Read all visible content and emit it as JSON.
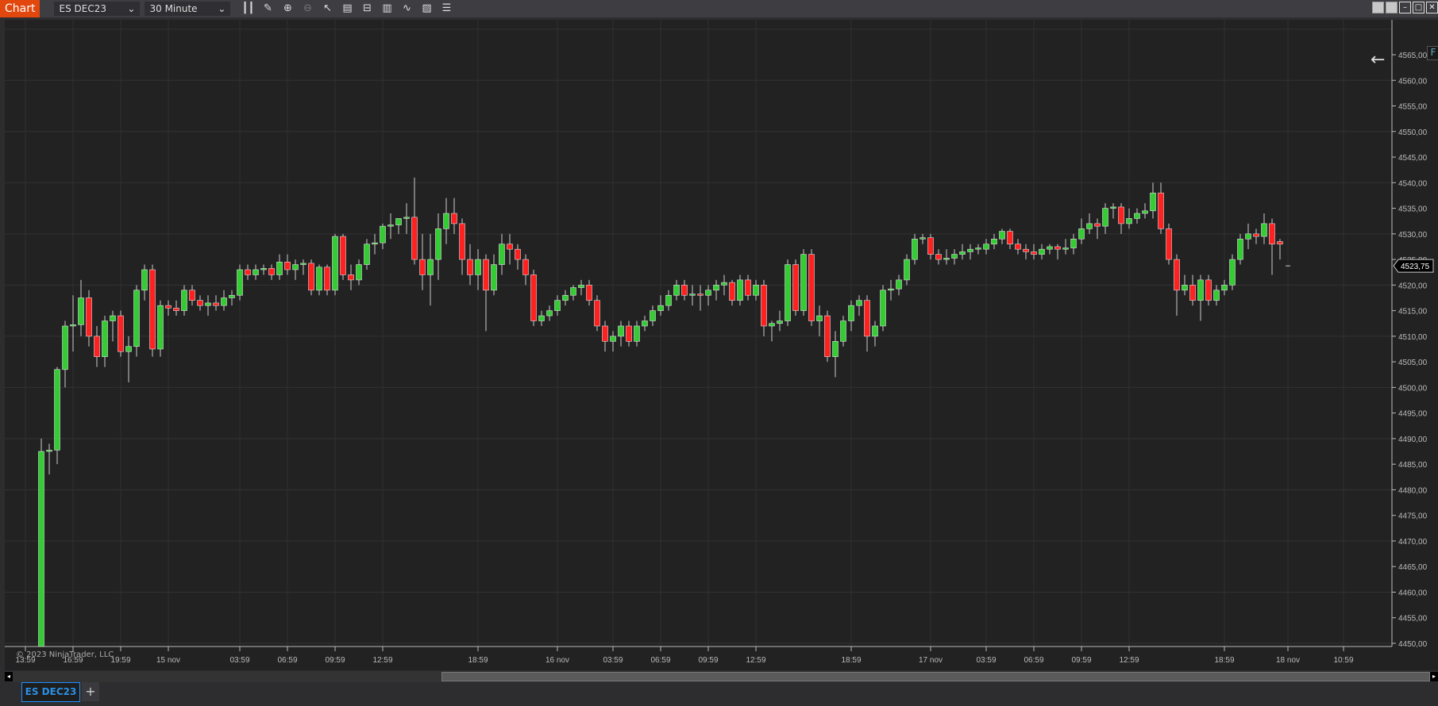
{
  "toolbar": {
    "title": "Chart",
    "instrument": "ES DEC23",
    "interval": "30 Minute",
    "tools": [
      "bar-chart-icon",
      "pencil-icon",
      "zoom-in-icon",
      "zoom-out-icon",
      "pointer-icon",
      "data-box-icon",
      "properties-icon",
      "indicators-icon",
      "strategies-icon",
      "templates-icon",
      "list-icon"
    ]
  },
  "chart": {
    "copyright": "© 2023 NinjaTrader, LLC",
    "f_button": "F",
    "current_price": "4523,75",
    "current_value": 4523.75,
    "colors": {
      "up": "#33cc33",
      "down": "#ff2020",
      "bg": "#222222",
      "grid": "#333333"
    },
    "price_labels": [
      "4565,00",
      "4560,00",
      "4555,00",
      "4550,00",
      "4545,00",
      "4540,00",
      "4535,00",
      "4530,00",
      "4525,00",
      "4520,00",
      "4515,00",
      "4510,00",
      "4505,00",
      "4500,00",
      "4495,00",
      "4490,00",
      "4485,00",
      "4480,00",
      "4475,00",
      "4470,00",
      "4465,00",
      "4460,00",
      "4455,00",
      "4450,00"
    ],
    "time_labels": [
      [
        "13:59",
        -2
      ],
      [
        "16:59",
        4
      ],
      [
        "19:59",
        10
      ],
      [
        "15 nov",
        16
      ],
      [
        "03:59",
        25
      ],
      [
        "06:59",
        31
      ],
      [
        "09:59",
        37
      ],
      [
        "12:59",
        43
      ],
      [
        "18:59",
        55
      ],
      [
        "16 nov",
        65
      ],
      [
        "03:59",
        72
      ],
      [
        "06:59",
        78
      ],
      [
        "09:59",
        84
      ],
      [
        "12:59",
        90
      ],
      [
        "18:59",
        102
      ],
      [
        "17 nov",
        112
      ],
      [
        "03:59",
        119
      ],
      [
        "06:59",
        125
      ],
      [
        "09:59",
        131
      ],
      [
        "12:59",
        137
      ],
      [
        "18:59",
        149
      ],
      [
        "18 nov",
        157
      ],
      [
        "10:59",
        164
      ]
    ],
    "candles": [
      [
        4448,
        4490,
        4440,
        4487.5
      ],
      [
        4487.5,
        4489,
        4483,
        4487.75
      ],
      [
        4487.75,
        4504,
        4485,
        4503.5
      ],
      [
        4503.5,
        4513,
        4500,
        4512
      ],
      [
        4512,
        4518,
        4507,
        4512.25
      ],
      [
        4512.25,
        4521,
        4510,
        4517.5
      ],
      [
        4517.5,
        4519,
        4508,
        4510
      ],
      [
        4510,
        4512,
        4504,
        4506
      ],
      [
        4506,
        4514,
        4504,
        4513
      ],
      [
        4513,
        4515,
        4509,
        4514
      ],
      [
        4514,
        4515,
        4506,
        4507
      ],
      [
        4507,
        4510,
        4501,
        4508
      ],
      [
        4508,
        4520,
        4506,
        4519
      ],
      [
        4519,
        4524,
        4517,
        4523
      ],
      [
        4523,
        4524,
        4506,
        4507.5
      ],
      [
        4507.5,
        4517,
        4506,
        4516
      ],
      [
        4516,
        4517,
        4514,
        4515.5
      ],
      [
        4515.5,
        4517,
        4514,
        4515
      ],
      [
        4515,
        4520,
        4514,
        4519
      ],
      [
        4519,
        4520,
        4516,
        4517
      ],
      [
        4517,
        4518,
        4515,
        4516
      ],
      [
        4516,
        4518,
        4514,
        4516.5
      ],
      [
        4516.5,
        4518,
        4515,
        4516
      ],
      [
        4516,
        4519,
        4515,
        4517.5
      ],
      [
        4517.5,
        4519,
        4516,
        4518
      ],
      [
        4518,
        4524,
        4517,
        4523
      ],
      [
        4523,
        4524,
        4521,
        4522
      ],
      [
        4522,
        4524,
        4521,
        4523
      ],
      [
        4523,
        4524,
        4522,
        4523.25
      ],
      [
        4523.25,
        4524,
        4521,
        4522
      ],
      [
        4522,
        4526,
        4521,
        4524.5
      ],
      [
        4524.5,
        4526,
        4522,
        4523
      ],
      [
        4523,
        4525,
        4521,
        4524
      ],
      [
        4524,
        4525,
        4522,
        4524.25
      ],
      [
        4524.25,
        4525,
        4518,
        4519
      ],
      [
        4519,
        4524,
        4518,
        4523.5
      ],
      [
        4523.5,
        4524,
        4518,
        4519
      ],
      [
        4519,
        4530,
        4518,
        4529.5
      ],
      [
        4529.5,
        4530,
        4521,
        4522
      ],
      [
        4522,
        4524,
        4519,
        4521
      ],
      [
        4521,
        4525,
        4520,
        4524
      ],
      [
        4524,
        4529,
        4523,
        4528
      ],
      [
        4528,
        4530,
        4526,
        4528.25
      ],
      [
        4528.25,
        4532,
        4527,
        4531.5
      ],
      [
        4531.5,
        4534,
        4529,
        4531.75
      ],
      [
        4531.75,
        4533,
        4530,
        4533
      ],
      [
        4533,
        4536,
        4530,
        4533.25
      ],
      [
        4533.25,
        4541,
        4524,
        4525
      ],
      [
        4525,
        4530,
        4519,
        4522
      ],
      [
        4522,
        4530,
        4516,
        4525
      ],
      [
        4525,
        4534,
        4521,
        4531
      ],
      [
        4531,
        4537,
        4528,
        4534
      ],
      [
        4534,
        4537,
        4530,
        4532
      ],
      [
        4532,
        4533,
        4522,
        4525
      ],
      [
        4525,
        4528,
        4520,
        4522
      ],
      [
        4522,
        4527,
        4519,
        4525
      ],
      [
        4525,
        4526,
        4511,
        4519
      ],
      [
        4519,
        4526,
        4518,
        4524
      ],
      [
        4524,
        4530,
        4522,
        4528
      ],
      [
        4528,
        4530,
        4524,
        4527
      ],
      [
        4527,
        4528,
        4523,
        4525
      ],
      [
        4525,
        4526,
        4520,
        4522
      ],
      [
        4522,
        4523,
        4512,
        4513
      ],
      [
        4513,
        4515,
        4512,
        4514
      ],
      [
        4514,
        4516,
        4513,
        4515
      ],
      [
        4515,
        4518,
        4514,
        4517
      ],
      [
        4517,
        4519,
        4516,
        4518
      ],
      [
        4518,
        4520,
        4517,
        4519.5
      ],
      [
        4519.5,
        4521,
        4518,
        4520
      ],
      [
        4520,
        4521,
        4516,
        4517
      ],
      [
        4517,
        4518,
        4511,
        4512
      ],
      [
        4512,
        4513,
        4507,
        4509
      ],
      [
        4509,
        4511,
        4507,
        4510
      ],
      [
        4510,
        4513,
        4508,
        4512
      ],
      [
        4512,
        4513,
        4508,
        4509
      ],
      [
        4509,
        4513,
        4508,
        4512
      ],
      [
        4512,
        4514,
        4511,
        4513
      ],
      [
        4513,
        4516,
        4512,
        4515
      ],
      [
        4515,
        4518,
        4514,
        4516
      ],
      [
        4516,
        4519,
        4515,
        4518
      ],
      [
        4518,
        4521,
        4517,
        4520
      ],
      [
        4520,
        4521,
        4517,
        4518
      ],
      [
        4518,
        4520,
        4516,
        4518.25
      ],
      [
        4518.25,
        4520,
        4515,
        4518
      ],
      [
        4518,
        4520,
        4516,
        4519
      ],
      [
        4519,
        4521,
        4517,
        4520
      ],
      [
        4520,
        4522,
        4518,
        4520.5
      ],
      [
        4520.5,
        4521,
        4516,
        4517
      ],
      [
        4517,
        4522,
        4516,
        4521
      ],
      [
        4521,
        4522,
        4517,
        4518
      ],
      [
        4518,
        4521,
        4517,
        4520
      ],
      [
        4520,
        4521,
        4510,
        4512
      ],
      [
        4512,
        4513,
        4509,
        4512.5
      ],
      [
        4512.5,
        4515,
        4511,
        4513
      ],
      [
        4513,
        4525,
        4512,
        4524
      ],
      [
        4524,
        4525,
        4514,
        4515
      ],
      [
        4515,
        4527,
        4514,
        4526
      ],
      [
        4526,
        4527,
        4512,
        4513
      ],
      [
        4513,
        4516,
        4510,
        4514
      ],
      [
        4514,
        4515,
        4505,
        4506
      ],
      [
        4506,
        4511,
        4502,
        4509
      ],
      [
        4509,
        4514,
        4508,
        4513
      ],
      [
        4513,
        4517,
        4511,
        4516
      ],
      [
        4516,
        4518,
        4514,
        4517
      ],
      [
        4517,
        4518,
        4507,
        4510
      ],
      [
        4510,
        4513,
        4508,
        4512
      ],
      [
        4512,
        4520,
        4511,
        4519
      ],
      [
        4519,
        4521,
        4517,
        4519.25
      ],
      [
        4519.25,
        4522,
        4518,
        4521
      ],
      [
        4521,
        4526,
        4520,
        4525
      ],
      [
        4525,
        4530,
        4524,
        4529
      ],
      [
        4529,
        4530,
        4528,
        4529.25
      ],
      [
        4529.25,
        4530,
        4525,
        4526
      ],
      [
        4526,
        4527,
        4524,
        4525
      ],
      [
        4525,
        4527,
        4524,
        4525.25
      ],
      [
        4525.25,
        4527,
        4524,
        4526
      ],
      [
        4526,
        4528,
        4525,
        4526.5
      ],
      [
        4526.5,
        4528,
        4525,
        4527
      ],
      [
        4527,
        4528,
        4526,
        4527.25
      ],
      [
        4527,
        4529,
        4526,
        4528
      ],
      [
        4528,
        4530,
        4527,
        4529
      ],
      [
        4529,
        4531,
        4528,
        4530.5
      ],
      [
        4530.5,
        4531,
        4527,
        4528
      ],
      [
        4528,
        4529,
        4526,
        4527
      ],
      [
        4527,
        4528,
        4525,
        4526.5
      ],
      [
        4526.5,
        4528,
        4525,
        4526
      ],
      [
        4526,
        4528,
        4525,
        4527
      ],
      [
        4527,
        4528,
        4526,
        4527.5
      ],
      [
        4527.5,
        4528,
        4525,
        4527
      ],
      [
        4527,
        4529,
        4526,
        4527.25
      ],
      [
        4527.25,
        4530,
        4526,
        4529
      ],
      [
        4529,
        4533,
        4528,
        4531
      ],
      [
        4531,
        4534,
        4530,
        4532
      ],
      [
        4532,
        4533,
        4529,
        4531.5
      ],
      [
        4531.5,
        4536,
        4530,
        4535
      ],
      [
        4535,
        4536,
        4533,
        4535.25
      ],
      [
        4535.25,
        4536,
        4530,
        4532
      ],
      [
        4532,
        4535,
        4531,
        4533
      ],
      [
        4533,
        4535,
        4532,
        4534
      ],
      [
        4534,
        4536,
        4533,
        4534.5
      ],
      [
        4534.5,
        4540,
        4533,
        4538
      ],
      [
        4538,
        4540,
        4530,
        4531
      ],
      [
        4531,
        4532,
        4524,
        4525
      ],
      [
        4525,
        4526,
        4514,
        4519
      ],
      [
        4519,
        4522,
        4518,
        4520
      ],
      [
        4520,
        4522,
        4516,
        4517
      ],
      [
        4517,
        4522,
        4513,
        4521
      ],
      [
        4521,
        4522,
        4516,
        4517
      ],
      [
        4517,
        4520,
        4516,
        4519
      ],
      [
        4519,
        4521,
        4518,
        4520
      ],
      [
        4520,
        4526,
        4519,
        4525
      ],
      [
        4525,
        4530,
        4524,
        4529
      ],
      [
        4529,
        4532,
        4527,
        4530
      ],
      [
        4530,
        4531,
        4528,
        4529.5
      ],
      [
        4529.5,
        4534,
        4528,
        4532
      ],
      [
        4532,
        4533,
        4522,
        4528
      ],
      [
        4528.5,
        4529,
        4525,
        4528
      ]
    ]
  },
  "tabs": [
    {
      "label": "ES DEC23"
    }
  ],
  "add_tab": "+"
}
